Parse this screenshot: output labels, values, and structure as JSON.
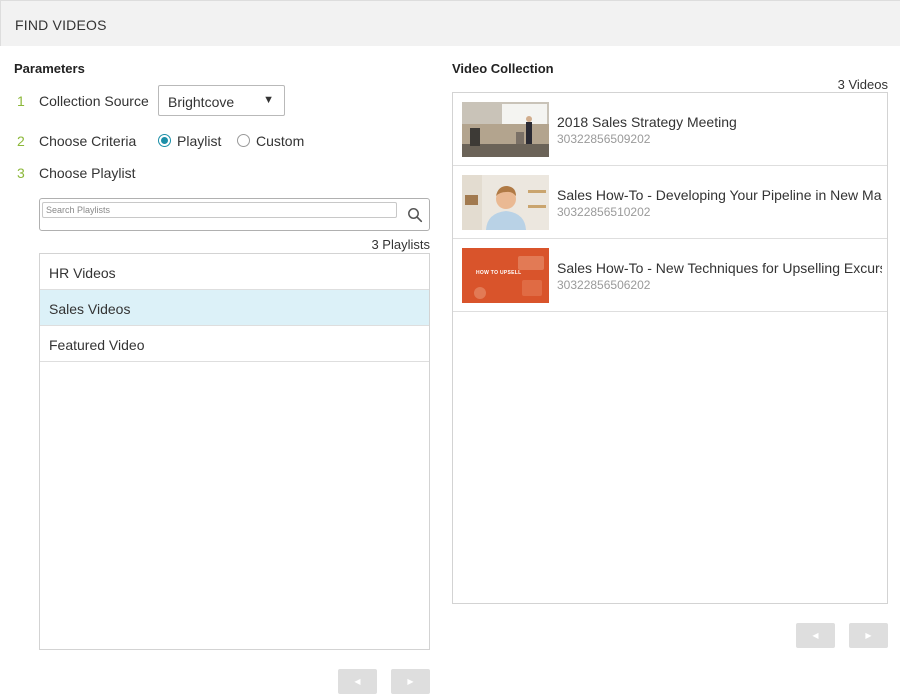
{
  "header": {
    "title": "FIND VIDEOS"
  },
  "parameters": {
    "title": "Parameters",
    "steps": [
      {
        "num": "1",
        "label": "Collection Source"
      },
      {
        "num": "2",
        "label": "Choose Criteria"
      },
      {
        "num": "3",
        "label": "Choose Playlist"
      }
    ],
    "source_select": {
      "value": "Brightcove",
      "caret": "▼"
    },
    "criteria": {
      "option_playlist": "Playlist",
      "option_custom": "Custom",
      "selected": "Playlist"
    },
    "search": {
      "placeholder": "Search Playlists",
      "icon": "search-icon"
    },
    "playlist_count": "3 Playlists",
    "playlists": [
      {
        "label": "HR Videos",
        "selected": false
      },
      {
        "label": "Sales Videos",
        "selected": true
      },
      {
        "label": "Featured Video",
        "selected": false
      }
    ],
    "pager": {
      "prev": "◀",
      "next": "▶"
    }
  },
  "collection": {
    "title": "Video Collection",
    "count": "3 Videos",
    "videos": [
      {
        "title": "2018 Sales Strategy Meeting",
        "id": "30322856509202",
        "thumb": "presentation-stage-thumbnail"
      },
      {
        "title": "Sales How-To - Developing Your Pipeline in New Marke",
        "id": "30322856510202",
        "thumb": "smiling-presenter-thumbnail"
      },
      {
        "title": "Sales How-To - New Techniques for Upselling Excursior",
        "id": "30322856506202",
        "thumb": "how-to-upsell-thumbnail",
        "thumb_text": "HOW TO UPSELL"
      }
    ],
    "pager": {
      "prev": "◀",
      "next": "▶"
    }
  },
  "colors": {
    "accent_green": "#8cb83a",
    "radio_teal": "#1c8fa8",
    "selected_row": "#dcf1f8",
    "upsell_orange": "#d9542b"
  }
}
